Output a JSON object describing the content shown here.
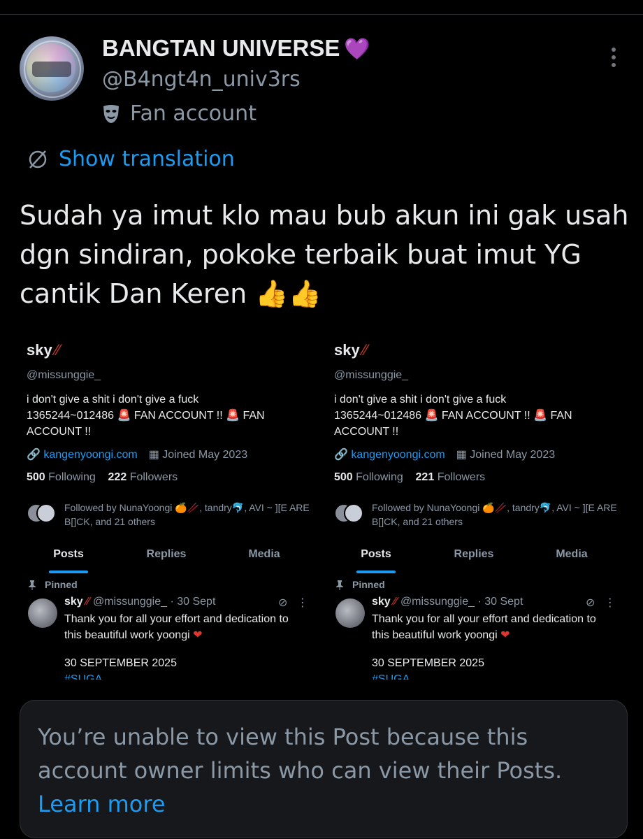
{
  "author": {
    "name": "BANGTAN UNIVERSE",
    "name_emoji": "💜",
    "handle": "@B4ngt4n_univ3rs",
    "badge": "Fan account"
  },
  "translation": {
    "label": "Show translation"
  },
  "tweet": {
    "text": "Sudah ya imut klo mau bub akun ini gak usah dgn sindiran, pokoke terbaik buat imut YG cantik Dan Keren 👍👍"
  },
  "profiles": [
    {
      "name": "sky",
      "handle": "@missunggie_",
      "bio_line1": "i don't give a shit i don't give a fuck",
      "bio_line2a": "1365244~012486 ",
      "bio_line2b": " FAN ACCOUNT !! ",
      "bio_line2c": " FAN",
      "bio_line3": "ACCOUNT !!",
      "link": "kangenyoongi.com",
      "joined": "Joined May 2023",
      "following_count": "500",
      "following_label": "Following",
      "followers_count": "222",
      "followers_label": "Followers",
      "followed_by": "Followed by NunaYoongi 🍊🥢, tandry🐬, AVI ~ ][E ARE B[]CK, and 21 others",
      "tabs": [
        "Posts",
        "Replies",
        "Media"
      ],
      "pinned_label": "Pinned",
      "post_handle": "@missunggie_ · 30 Sept",
      "post_text": "Thank you for all your effort and dedication to this beautiful work yoongi",
      "post_date": "30 SEPTEMBER 2025",
      "post_tag": "#SUGA"
    },
    {
      "name": "sky",
      "handle": "@missunggie_",
      "bio_line1": "i don't give a shit i don't give a fuck",
      "bio_line2a": "1365244~012486 ",
      "bio_line2b": " FAN ACCOUNT !! ",
      "bio_line2c": " FAN",
      "bio_line3": "ACCOUNT !!",
      "link": "kangenyoongi.com",
      "joined": "Joined May 2023",
      "following_count": "500",
      "following_label": "Following",
      "followers_count": "221",
      "followers_label": "Followers",
      "followed_by": "Followed by NunaYoongi 🍊🥢, tandry🐬, AVI ~ ][E ARE B[]CK, and 21 others",
      "tabs": [
        "Posts",
        "Replies",
        "Media"
      ],
      "pinned_label": "Pinned",
      "post_handle": "@missunggie_ · 30 Sept",
      "post_text": "Thank you for all your effort and dedication to this beautiful work yoongi",
      "post_date": "30 SEPTEMBER 2025",
      "post_tag": "#SUGA"
    }
  ],
  "notice": {
    "message": "You’re unable to view this Post because this account owner limits who can view their Posts.",
    "link_label": "Learn more"
  },
  "colors": {
    "accent": "#1d9bf0",
    "background": "#000000",
    "muted": "#8b98a5"
  }
}
